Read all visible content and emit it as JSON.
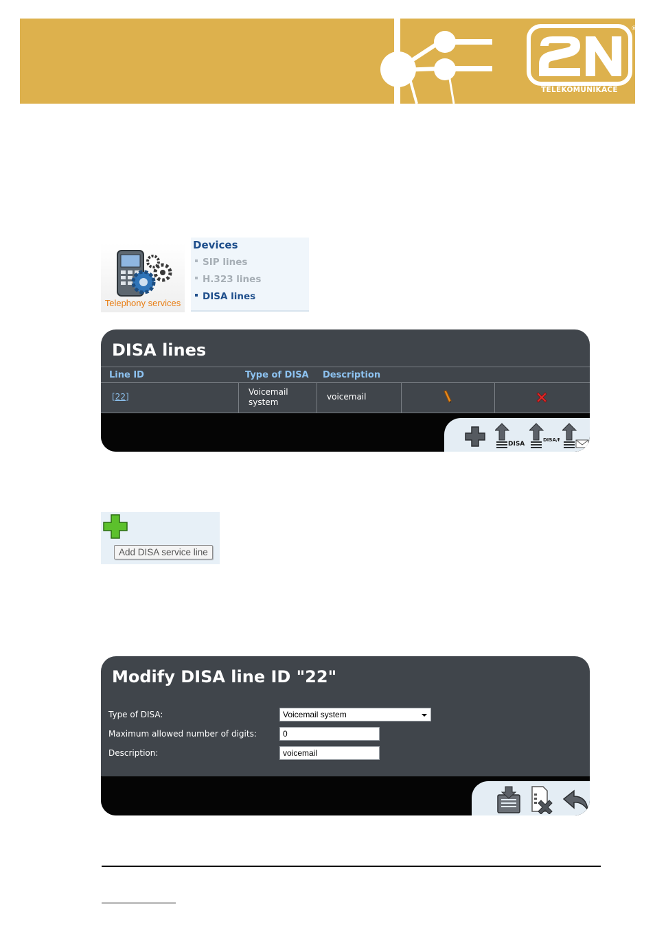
{
  "brand": {
    "logo_text": "2N",
    "logo_subtitle": "TELEKOMUNIKACE",
    "registered_mark": "®"
  },
  "telephony": {
    "label": "Telephony services"
  },
  "devices_menu": {
    "heading": "Devices",
    "items": [
      {
        "label": "SIP lines",
        "active": false
      },
      {
        "label": "H.323 lines",
        "active": false
      },
      {
        "label": "DISA lines",
        "active": true
      }
    ]
  },
  "disa_lines": {
    "title": "DISA lines",
    "columns": [
      "Line ID",
      "Type of DISA",
      "Description"
    ],
    "rows": [
      {
        "line_id": "[22]",
        "type_line1": "Voicemail",
        "type_line2": "system",
        "description": "voicemail",
        "edit_icon": "pencil-icon",
        "delete_icon": "delete-x-icon"
      }
    ],
    "toolbar": [
      {
        "icon": "add-plus-icon"
      },
      {
        "icon": "upload-disa-icon",
        "label": "DISA"
      },
      {
        "icon": "upload-disa-nr-icon",
        "label": "DISA/NR"
      },
      {
        "icon": "upload-mail-icon"
      }
    ]
  },
  "add_tooltip": {
    "icon": "add-plus-icon",
    "text": "Add DISA service line"
  },
  "modify": {
    "title": "Modify DISA line ID \"22\"",
    "fields": {
      "type_label": "Type of DISA:",
      "type_value": "Voicemail system",
      "digits_label": "Maximum allowed number of digits:",
      "digits_value": "0",
      "description_label": "Description:",
      "description_value": "voicemail"
    },
    "toolbar": [
      {
        "icon": "save-icon"
      },
      {
        "icon": "delete-document-icon"
      },
      {
        "icon": "back-arrow-icon"
      }
    ]
  },
  "colors": {
    "banner": "#ddb14d",
    "panel": "#40454b",
    "panel_footer": "#050505",
    "header_text": "#8dc2f0",
    "menu_active": "#1f4f8c",
    "telephony_label": "#e87d12"
  }
}
